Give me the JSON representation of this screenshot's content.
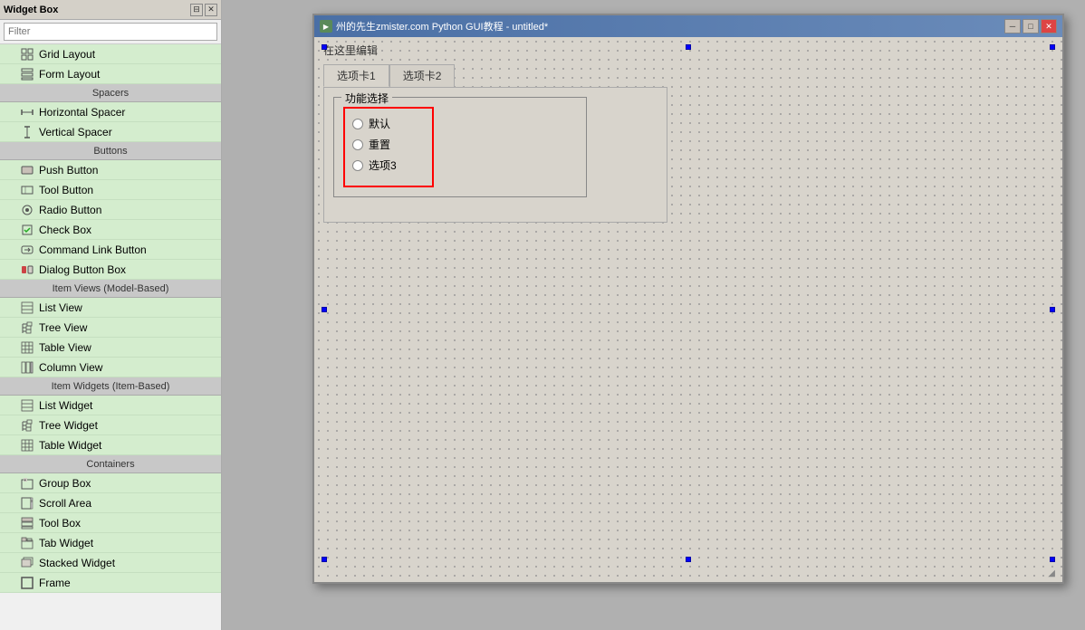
{
  "widgetBox": {
    "title": "Widget Box",
    "titlebarBtns": [
      "⊟",
      "✕"
    ],
    "filter": {
      "placeholder": "Filter",
      "value": ""
    },
    "sections": [
      {
        "type": "items",
        "items": [
          {
            "icon": "grid-icon",
            "label": "Grid Layout"
          },
          {
            "icon": "form-icon",
            "label": "Form Layout"
          }
        ]
      },
      {
        "type": "header",
        "label": "Spacers"
      },
      {
        "type": "items",
        "items": [
          {
            "icon": "hspacer-icon",
            "label": "Horizontal Spacer"
          },
          {
            "icon": "vspacer-icon",
            "label": "Vertical Spacer"
          }
        ]
      },
      {
        "type": "header",
        "label": "Buttons"
      },
      {
        "type": "items",
        "items": [
          {
            "icon": "pushbtn-icon",
            "label": "Push Button"
          },
          {
            "icon": "toolbtn-icon",
            "label": "Tool Button"
          },
          {
            "icon": "radiobtn-icon",
            "label": "Radio Button"
          },
          {
            "icon": "checkbox-icon",
            "label": "Check Box"
          },
          {
            "icon": "cmdlink-icon",
            "label": "Command Link Button"
          },
          {
            "icon": "dialogbtn-icon",
            "label": "Dialog Button Box"
          }
        ]
      },
      {
        "type": "header",
        "label": "Item Views (Model-Based)"
      },
      {
        "type": "items",
        "items": [
          {
            "icon": "listview-icon",
            "label": "List View"
          },
          {
            "icon": "treeview-icon",
            "label": "Tree View"
          },
          {
            "icon": "tableview-icon",
            "label": "Table View"
          },
          {
            "icon": "columnview-icon",
            "label": "Column View"
          }
        ]
      },
      {
        "type": "header",
        "label": "Item Widgets (Item-Based)"
      },
      {
        "type": "items",
        "items": [
          {
            "icon": "listwidget-icon",
            "label": "List Widget"
          },
          {
            "icon": "treewidget-icon",
            "label": "Tree Widget"
          },
          {
            "icon": "tablewidget-icon",
            "label": "Table Widget"
          }
        ]
      },
      {
        "type": "header",
        "label": "Containers"
      },
      {
        "type": "items",
        "items": [
          {
            "icon": "groupbox-icon",
            "label": "Group Box"
          },
          {
            "icon": "scrollarea-icon",
            "label": "Scroll Area"
          },
          {
            "icon": "toolbox-icon",
            "label": "Tool Box"
          },
          {
            "icon": "tabwidget-icon",
            "label": "Tab Widget"
          },
          {
            "icon": "stackedwidget-icon",
            "label": "Stacked Widget"
          },
          {
            "icon": "frame-icon",
            "label": "Frame"
          }
        ]
      }
    ]
  },
  "mainWindow": {
    "title": "州的先生zmister.com Python GUI教程 - untitled*",
    "addressBarText": "在这里编辑",
    "tabs": [
      {
        "label": "选项卡1",
        "active": true
      },
      {
        "label": "选项卡2",
        "active": false
      }
    ],
    "groupBoxTitle": "功能选择",
    "radioOptions": [
      {
        "label": "默认",
        "checked": false
      },
      {
        "label": "重置",
        "checked": false
      },
      {
        "label": "选项3",
        "checked": false
      }
    ]
  },
  "icons": {
    "minimize": "⊟",
    "maximize": "□",
    "close": "✕",
    "radio_unchecked": "○"
  }
}
